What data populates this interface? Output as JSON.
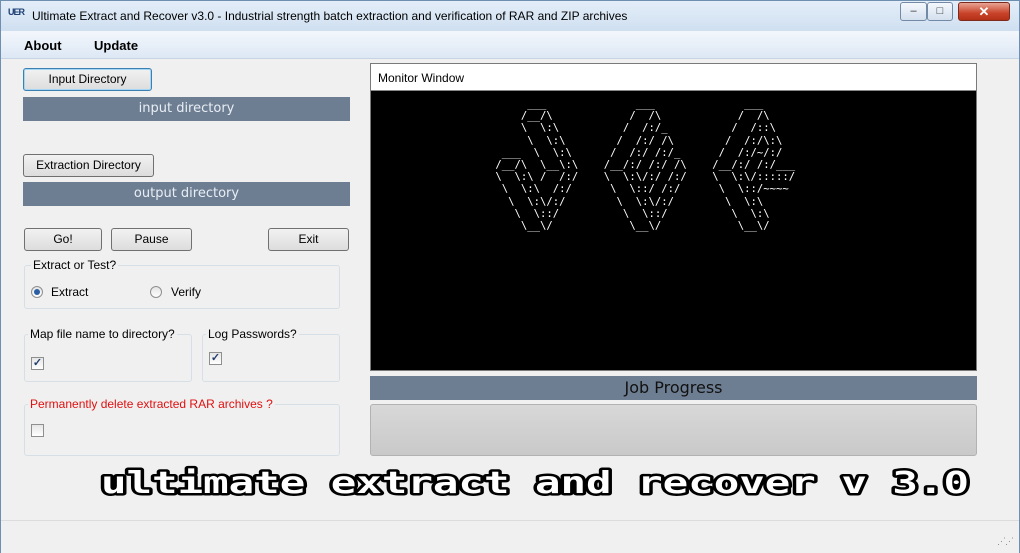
{
  "window": {
    "title": "Ultimate Extract and Recover v3.0  - Industrial strength batch extraction and verification of RAR and ZIP archives",
    "icon_text": "UER",
    "minimize": "‒",
    "maximize": "□",
    "close": "✕"
  },
  "menu": {
    "about": "About",
    "update": "Update"
  },
  "input": {
    "button": "Input Directory",
    "path": "input directory"
  },
  "output": {
    "button": "Extraction Directory",
    "path": "output directory"
  },
  "actions": {
    "go": "Go!",
    "pause": "Pause",
    "exit": "Exit"
  },
  "mode": {
    "label": "Extract or Test?",
    "extract": "Extract",
    "verify": "Verify",
    "selected": "Extract"
  },
  "map_dir": {
    "label": "Map file name to directory?",
    "checked": true
  },
  "log_passwords": {
    "label": "Log Passwords?",
    "checked": true
  },
  "delete_rar": {
    "label": "Permanently delete extracted RAR archives  ?",
    "checked": false,
    "color": "#e01010"
  },
  "monitor": {
    "title": "Monitor Window",
    "ascii": "      ___              ___              ___\n     /__/\\            /  /\\            /  /\\\n     \\  \\:\\          /  /:/_          /  /::\\\n      \\  \\:\\        /  /:/ /\\        /  /:/\\:\\\n  ___  \\  \\:\\      /  /:/ /:/_      /  /:/~/:/\n /__/\\  \\__\\:\\    /__/:/ /:/ /\\    /__/:/ /:/___\n \\  \\:\\ /  /:/    \\  \\:\\/:/ /:/    \\  \\:\\/:::::/\n  \\  \\:\\  /:/      \\  \\::/ /:/      \\  \\::/~~~~\n   \\  \\:\\/:/        \\  \\:\\/:/        \\  \\:\\\n    \\  \\::/          \\  \\::/          \\  \\:\\\n     \\__\\/            \\__\\/            \\__\\/"
  },
  "job": {
    "label": "Job Progress",
    "progress": 0
  },
  "banner": {
    "text": "ultimate extract and recover v 3.0"
  }
}
